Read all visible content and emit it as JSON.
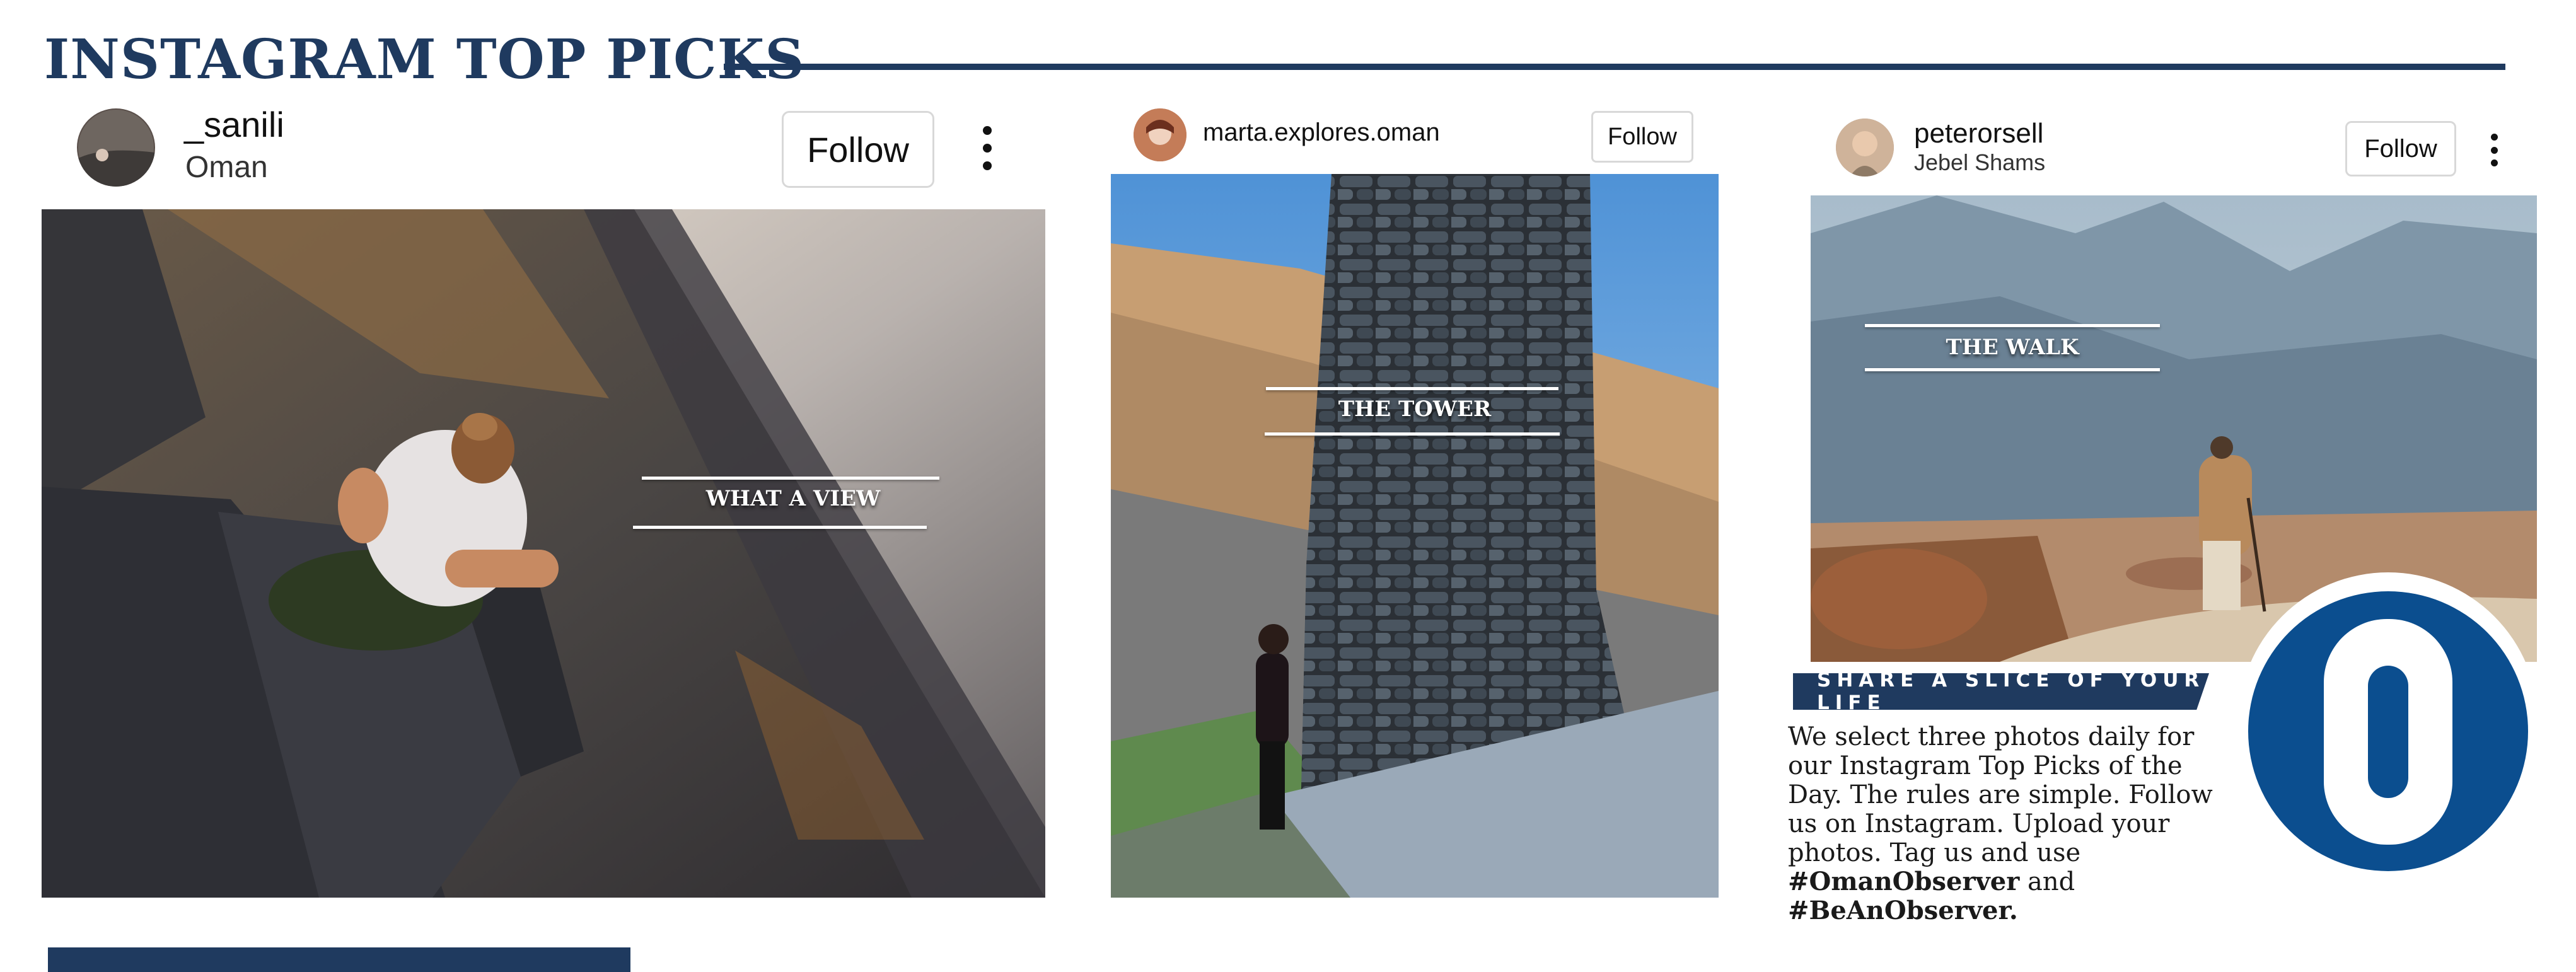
{
  "page": {
    "title": "INSTAGRAM TOP PICKS",
    "accent_color": "#1f3a5f"
  },
  "posts": [
    {
      "username": "_sanili",
      "location": "Oman",
      "follow_label": "Follow",
      "menu_icon": "more-vertical-icon",
      "caption": "WHAT A VIEW"
    },
    {
      "username": "marta.explores.oman",
      "location": "",
      "follow_label": "Follow",
      "caption": "THE TOWER"
    },
    {
      "username": "peterorsell",
      "location": "Jebel Shams",
      "follow_label": "Follow",
      "menu_icon": "more-vertical-icon",
      "caption": "THE WALK"
    }
  ],
  "promo": {
    "banner": "SHARE A SLICE OF YOUR LIFE",
    "text_lines": [
      "We select three photos daily for",
      "our Instagram Top Picks of the",
      "Day. The rules are simple. Follow",
      "us on Instagram. Upload your",
      "photos. Tag us and use"
    ],
    "hashtag_1": "#OmanObserver",
    "joiner": "and",
    "hashtag_2": "#BeAnObserver.",
    "logo_letter": "O",
    "logo_color": "#0b4e8f"
  }
}
